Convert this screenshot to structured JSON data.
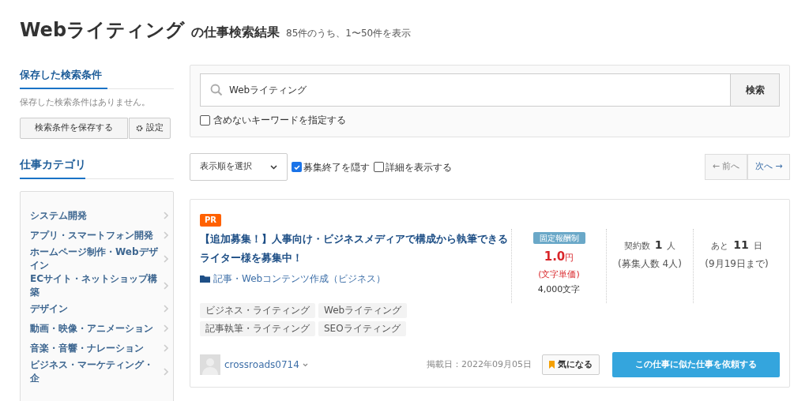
{
  "header": {
    "keyword": "Webライティング",
    "suffix": "の仕事検索結果",
    "count": "85件のうち、1〜50件を表示"
  },
  "sidebar": {
    "saved": {
      "heading": "保存した検索条件",
      "empty": "保存した検索条件はありません。",
      "save_button": "検索条件を保存する",
      "settings_button": "設定"
    },
    "categories": {
      "heading": "仕事カテゴリ",
      "items": [
        {
          "label": "システム開発"
        },
        {
          "label": "アプリ・スマートフォン開発"
        },
        {
          "label": "ホームページ制作・Webデザイン"
        },
        {
          "label": "ECサイト・ネットショップ構築"
        },
        {
          "label": "デザイン"
        },
        {
          "label": "動画・映像・アニメーション"
        },
        {
          "label": "音楽・音響・ナレーション"
        },
        {
          "label": "ビジネス・マーケティング・企"
        }
      ]
    }
  },
  "search": {
    "value": "Webライティング",
    "button": "検索",
    "exclude": {
      "label": "含めないキーワードを指定する",
      "checked": false
    }
  },
  "toolbar": {
    "sort": "表示順を選択",
    "filters": [
      {
        "label": "募集終了を隠す",
        "checked": true
      },
      {
        "label": "詳細を表示する",
        "checked": false
      }
    ],
    "prev": {
      "label": "← 前へ",
      "disabled": true
    },
    "next": {
      "label": "次へ →",
      "disabled": false
    }
  },
  "jobs": [
    {
      "badge": "PR",
      "title": "【追加募集！】人事向け・ビジネスメディアで構成から執筆できるライター様を募集中！",
      "category": "記事・Webコンテンツ作成（ビジネス）",
      "tags": [
        "ビジネス・ライティング",
        "Webライティング",
        "記事執筆・ライティング",
        "SEOライティング"
      ],
      "pay_type": "固定報酬制",
      "price": "1.0",
      "price_unit": "円",
      "price_note": "(文字単価)",
      "volume": "4,000文字",
      "contracts": {
        "label": "契約数",
        "value": "1",
        "unit": "人",
        "note": "(募集人数 4人)"
      },
      "remaining": {
        "label": "あと",
        "value": "11",
        "unit": "日",
        "note": "(9月19日まで)"
      },
      "client": "crossroads0714",
      "posted": "掲載日：2022年09月05日",
      "bookmark": "気になる",
      "cta": "この仕事に似た仕事を依頼する"
    }
  ]
}
